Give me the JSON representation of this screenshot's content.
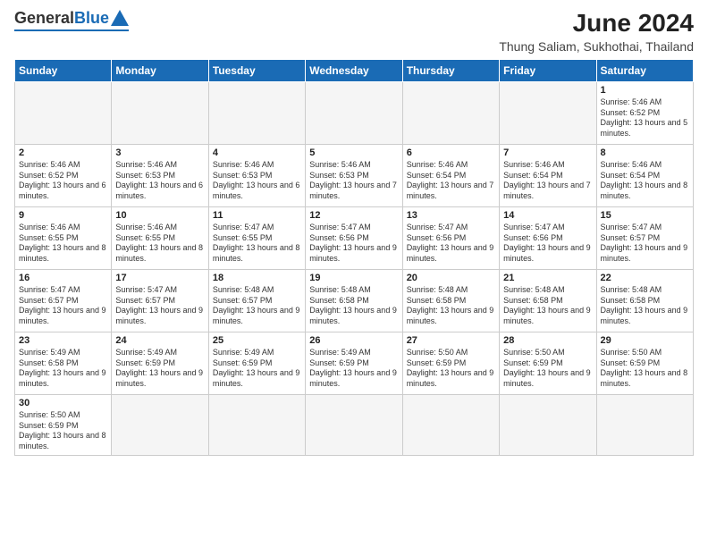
{
  "header": {
    "logo_general": "General",
    "logo_blue": "Blue",
    "main_title": "June 2024",
    "sub_title": "Thung Saliam, Sukhothai, Thailand"
  },
  "days_of_week": [
    "Sunday",
    "Monday",
    "Tuesday",
    "Wednesday",
    "Thursday",
    "Friday",
    "Saturday"
  ],
  "weeks": [
    [
      {
        "day": "",
        "info": ""
      },
      {
        "day": "",
        "info": ""
      },
      {
        "day": "",
        "info": ""
      },
      {
        "day": "",
        "info": ""
      },
      {
        "day": "",
        "info": ""
      },
      {
        "day": "",
        "info": ""
      },
      {
        "day": "1",
        "info": "Sunrise: 5:46 AM\nSunset: 6:52 PM\nDaylight: 13 hours and 5 minutes."
      }
    ],
    [
      {
        "day": "2",
        "info": "Sunrise: 5:46 AM\nSunset: 6:52 PM\nDaylight: 13 hours and 6 minutes."
      },
      {
        "day": "3",
        "info": "Sunrise: 5:46 AM\nSunset: 6:53 PM\nDaylight: 13 hours and 6 minutes."
      },
      {
        "day": "4",
        "info": "Sunrise: 5:46 AM\nSunset: 6:53 PM\nDaylight: 13 hours and 6 minutes."
      },
      {
        "day": "5",
        "info": "Sunrise: 5:46 AM\nSunset: 6:53 PM\nDaylight: 13 hours and 7 minutes."
      },
      {
        "day": "6",
        "info": "Sunrise: 5:46 AM\nSunset: 6:54 PM\nDaylight: 13 hours and 7 minutes."
      },
      {
        "day": "7",
        "info": "Sunrise: 5:46 AM\nSunset: 6:54 PM\nDaylight: 13 hours and 7 minutes."
      },
      {
        "day": "8",
        "info": "Sunrise: 5:46 AM\nSunset: 6:54 PM\nDaylight: 13 hours and 8 minutes."
      }
    ],
    [
      {
        "day": "9",
        "info": "Sunrise: 5:46 AM\nSunset: 6:55 PM\nDaylight: 13 hours and 8 minutes."
      },
      {
        "day": "10",
        "info": "Sunrise: 5:46 AM\nSunset: 6:55 PM\nDaylight: 13 hours and 8 minutes."
      },
      {
        "day": "11",
        "info": "Sunrise: 5:47 AM\nSunset: 6:55 PM\nDaylight: 13 hours and 8 minutes."
      },
      {
        "day": "12",
        "info": "Sunrise: 5:47 AM\nSunset: 6:56 PM\nDaylight: 13 hours and 9 minutes."
      },
      {
        "day": "13",
        "info": "Sunrise: 5:47 AM\nSunset: 6:56 PM\nDaylight: 13 hours and 9 minutes."
      },
      {
        "day": "14",
        "info": "Sunrise: 5:47 AM\nSunset: 6:56 PM\nDaylight: 13 hours and 9 minutes."
      },
      {
        "day": "15",
        "info": "Sunrise: 5:47 AM\nSunset: 6:57 PM\nDaylight: 13 hours and 9 minutes."
      }
    ],
    [
      {
        "day": "16",
        "info": "Sunrise: 5:47 AM\nSunset: 6:57 PM\nDaylight: 13 hours and 9 minutes."
      },
      {
        "day": "17",
        "info": "Sunrise: 5:47 AM\nSunset: 6:57 PM\nDaylight: 13 hours and 9 minutes."
      },
      {
        "day": "18",
        "info": "Sunrise: 5:48 AM\nSunset: 6:57 PM\nDaylight: 13 hours and 9 minutes."
      },
      {
        "day": "19",
        "info": "Sunrise: 5:48 AM\nSunset: 6:58 PM\nDaylight: 13 hours and 9 minutes."
      },
      {
        "day": "20",
        "info": "Sunrise: 5:48 AM\nSunset: 6:58 PM\nDaylight: 13 hours and 9 minutes."
      },
      {
        "day": "21",
        "info": "Sunrise: 5:48 AM\nSunset: 6:58 PM\nDaylight: 13 hours and 9 minutes."
      },
      {
        "day": "22",
        "info": "Sunrise: 5:48 AM\nSunset: 6:58 PM\nDaylight: 13 hours and 9 minutes."
      }
    ],
    [
      {
        "day": "23",
        "info": "Sunrise: 5:49 AM\nSunset: 6:58 PM\nDaylight: 13 hours and 9 minutes."
      },
      {
        "day": "24",
        "info": "Sunrise: 5:49 AM\nSunset: 6:59 PM\nDaylight: 13 hours and 9 minutes."
      },
      {
        "day": "25",
        "info": "Sunrise: 5:49 AM\nSunset: 6:59 PM\nDaylight: 13 hours and 9 minutes."
      },
      {
        "day": "26",
        "info": "Sunrise: 5:49 AM\nSunset: 6:59 PM\nDaylight: 13 hours and 9 minutes."
      },
      {
        "day": "27",
        "info": "Sunrise: 5:50 AM\nSunset: 6:59 PM\nDaylight: 13 hours and 9 minutes."
      },
      {
        "day": "28",
        "info": "Sunrise: 5:50 AM\nSunset: 6:59 PM\nDaylight: 13 hours and 9 minutes."
      },
      {
        "day": "29",
        "info": "Sunrise: 5:50 AM\nSunset: 6:59 PM\nDaylight: 13 hours and 8 minutes."
      }
    ],
    [
      {
        "day": "30",
        "info": "Sunrise: 5:50 AM\nSunset: 6:59 PM\nDaylight: 13 hours and 8 minutes."
      },
      {
        "day": "",
        "info": ""
      },
      {
        "day": "",
        "info": ""
      },
      {
        "day": "",
        "info": ""
      },
      {
        "day": "",
        "info": ""
      },
      {
        "day": "",
        "info": ""
      },
      {
        "day": "",
        "info": ""
      }
    ]
  ]
}
